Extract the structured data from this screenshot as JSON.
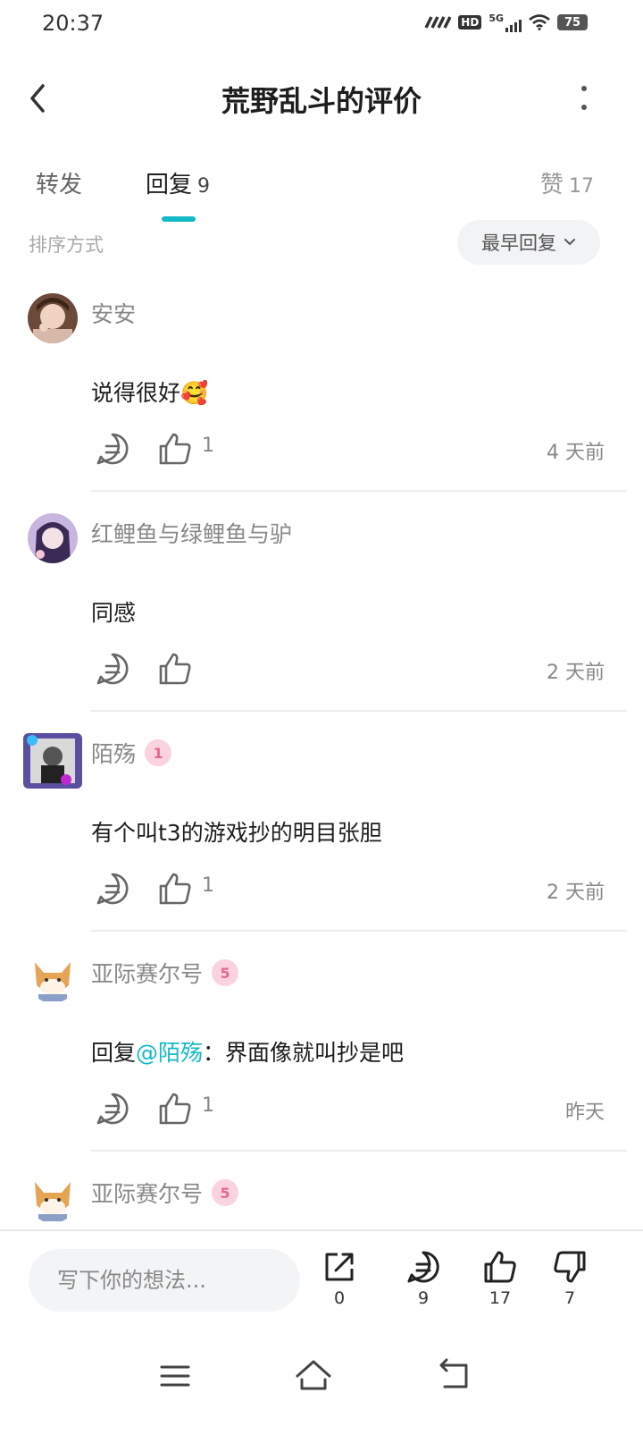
{
  "status_bar": {
    "time": "20:37",
    "network": "HD",
    "signal": "5G",
    "battery": "75"
  },
  "header": {
    "title": "荒野乱斗的评价",
    "back_icon": "chevron-left-icon",
    "more_icon": "more-vertical-icon"
  },
  "tabs": {
    "forward_label": "转发",
    "reply_label": "回复",
    "reply_count": "9",
    "like_label": "赞",
    "like_count": "17"
  },
  "sort": {
    "label": "排序方式",
    "current": "最早回复"
  },
  "comments": [
    {
      "username": "安安",
      "text": "说得很好🥰",
      "likes": "1",
      "time": "4 天前"
    },
    {
      "username": "红鲤鱼与绿鲤鱼与驴",
      "text": "同感",
      "likes": "",
      "time": "2 天前"
    },
    {
      "username": "陌殇",
      "badge": "1",
      "text": "有个叫t3的游戏抄的明目张胆",
      "likes": "1",
      "time": "2 天前"
    },
    {
      "username": "亚际赛尔号",
      "badge": "5",
      "reply_prefix": "回复",
      "mention": "@陌殇",
      "text": "：界面像就叫抄是吧",
      "likes": "1",
      "time": "昨天"
    },
    {
      "username": "亚际赛尔号",
      "badge": "5"
    }
  ],
  "bottom_bar": {
    "input_placeholder": "写下你的想法...",
    "share_count": "0",
    "comment_count": "9",
    "like_count": "17",
    "dislike_count": "7"
  },
  "colors": {
    "accent": "#14b9c8",
    "badge_bg": "#fbd3df",
    "badge_fg": "#e8668c"
  }
}
